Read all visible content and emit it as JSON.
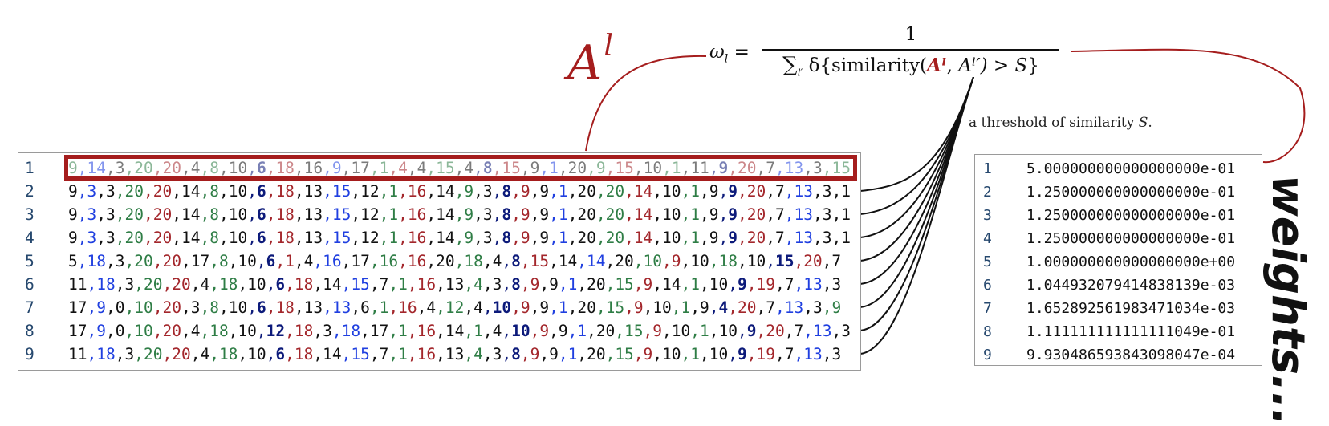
{
  "a_label": {
    "base": "A",
    "sup": "l"
  },
  "formula": {
    "lhs": "ω",
    "lhs_sub": "l",
    "eq": "=",
    "numerator": "1",
    "denominator": {
      "sum": "∑",
      "sum_sub": "l′",
      "delta": "δ{similarity(",
      "highlight": "Aˡ",
      "mid": ", ",
      "rest": "Aˡ′) > ",
      "var": "S",
      "close": "}"
    }
  },
  "threshold": {
    "text": "a threshold of similarity ",
    "var": "S",
    "end": "."
  },
  "sequences": [
    {
      "n": "1",
      "tokens": [
        [
          "9",
          "g"
        ],
        [
          "14",
          "b"
        ],
        [
          "3",
          "k"
        ],
        [
          "20",
          "g"
        ],
        [
          "20",
          "r"
        ],
        [
          "4",
          "k"
        ],
        [
          "8",
          "g"
        ],
        [
          "10",
          "k"
        ],
        [
          "6",
          "n"
        ],
        [
          "18",
          "r"
        ],
        [
          "16",
          "k"
        ],
        [
          "9",
          "b"
        ],
        [
          "17",
          "k"
        ],
        [
          "1",
          "g"
        ],
        [
          "4",
          "r"
        ],
        [
          "4",
          "k"
        ],
        [
          "15",
          "g"
        ],
        [
          "4",
          "k"
        ],
        [
          "8",
          "n"
        ],
        [
          "15",
          "r"
        ],
        [
          "9",
          "k"
        ],
        [
          "1",
          "b"
        ],
        [
          "20",
          "k"
        ],
        [
          "9",
          "g"
        ],
        [
          "15",
          "r"
        ],
        [
          "10",
          "k"
        ],
        [
          "1",
          "g"
        ],
        [
          "11",
          "k"
        ],
        [
          "9",
          "n"
        ],
        [
          "20",
          "r"
        ],
        [
          "7",
          "k"
        ],
        [
          "13",
          "b"
        ],
        [
          "3",
          "k"
        ],
        [
          "15",
          "g"
        ]
      ]
    },
    {
      "n": "2",
      "tokens": [
        [
          "9",
          "k"
        ],
        [
          "3",
          "b"
        ],
        [
          "3",
          "k"
        ],
        [
          "20",
          "g"
        ],
        [
          "20",
          "r"
        ],
        [
          "14",
          "k"
        ],
        [
          "8",
          "g"
        ],
        [
          "10",
          "k"
        ],
        [
          "6",
          "n"
        ],
        [
          "18",
          "r"
        ],
        [
          "13",
          "k"
        ],
        [
          "15",
          "b"
        ],
        [
          "12",
          "k"
        ],
        [
          "1",
          "g"
        ],
        [
          "16",
          "r"
        ],
        [
          "14",
          "k"
        ],
        [
          "9",
          "g"
        ],
        [
          "3",
          "k"
        ],
        [
          "8",
          "n"
        ],
        [
          "9",
          "r"
        ],
        [
          "9",
          "k"
        ],
        [
          "1",
          "b"
        ],
        [
          "20",
          "k"
        ],
        [
          "20",
          "g"
        ],
        [
          "14",
          "r"
        ],
        [
          "10",
          "k"
        ],
        [
          "1",
          "g"
        ],
        [
          "9",
          "k"
        ],
        [
          "9",
          "n"
        ],
        [
          "20",
          "r"
        ],
        [
          "7",
          "k"
        ],
        [
          "13",
          "b"
        ],
        [
          "3",
          "k"
        ],
        [
          "1",
          "k"
        ]
      ]
    },
    {
      "n": "3",
      "tokens": [
        [
          "9",
          "k"
        ],
        [
          "3",
          "b"
        ],
        [
          "3",
          "k"
        ],
        [
          "20",
          "g"
        ],
        [
          "20",
          "r"
        ],
        [
          "14",
          "k"
        ],
        [
          "8",
          "g"
        ],
        [
          "10",
          "k"
        ],
        [
          "6",
          "n"
        ],
        [
          "18",
          "r"
        ],
        [
          "13",
          "k"
        ],
        [
          "15",
          "b"
        ],
        [
          "12",
          "k"
        ],
        [
          "1",
          "g"
        ],
        [
          "16",
          "r"
        ],
        [
          "14",
          "k"
        ],
        [
          "9",
          "g"
        ],
        [
          "3",
          "k"
        ],
        [
          "8",
          "n"
        ],
        [
          "9",
          "r"
        ],
        [
          "9",
          "k"
        ],
        [
          "1",
          "b"
        ],
        [
          "20",
          "k"
        ],
        [
          "20",
          "g"
        ],
        [
          "14",
          "r"
        ],
        [
          "10",
          "k"
        ],
        [
          "1",
          "g"
        ],
        [
          "9",
          "k"
        ],
        [
          "9",
          "n"
        ],
        [
          "20",
          "r"
        ],
        [
          "7",
          "k"
        ],
        [
          "13",
          "b"
        ],
        [
          "3",
          "k"
        ],
        [
          "1",
          "k"
        ]
      ]
    },
    {
      "n": "4",
      "tokens": [
        [
          "9",
          "k"
        ],
        [
          "3",
          "b"
        ],
        [
          "3",
          "k"
        ],
        [
          "20",
          "g"
        ],
        [
          "20",
          "r"
        ],
        [
          "14",
          "k"
        ],
        [
          "8",
          "g"
        ],
        [
          "10",
          "k"
        ],
        [
          "6",
          "n"
        ],
        [
          "18",
          "r"
        ],
        [
          "13",
          "k"
        ],
        [
          "15",
          "b"
        ],
        [
          "12",
          "k"
        ],
        [
          "1",
          "g"
        ],
        [
          "16",
          "r"
        ],
        [
          "14",
          "k"
        ],
        [
          "9",
          "g"
        ],
        [
          "3",
          "k"
        ],
        [
          "8",
          "n"
        ],
        [
          "9",
          "r"
        ],
        [
          "9",
          "k"
        ],
        [
          "1",
          "b"
        ],
        [
          "20",
          "k"
        ],
        [
          "20",
          "g"
        ],
        [
          "14",
          "r"
        ],
        [
          "10",
          "k"
        ],
        [
          "1",
          "g"
        ],
        [
          "9",
          "k"
        ],
        [
          "9",
          "n"
        ],
        [
          "20",
          "r"
        ],
        [
          "7",
          "k"
        ],
        [
          "13",
          "b"
        ],
        [
          "3",
          "k"
        ],
        [
          "1",
          "k"
        ]
      ]
    },
    {
      "n": "5",
      "tokens": [
        [
          "5",
          "k"
        ],
        [
          "18",
          "b"
        ],
        [
          "3",
          "k"
        ],
        [
          "20",
          "g"
        ],
        [
          "20",
          "r"
        ],
        [
          "17",
          "k"
        ],
        [
          "8",
          "g"
        ],
        [
          "10",
          "k"
        ],
        [
          "6",
          "n"
        ],
        [
          "1",
          "r"
        ],
        [
          "4",
          "k"
        ],
        [
          "16",
          "b"
        ],
        [
          "17",
          "k"
        ],
        [
          "16",
          "g"
        ],
        [
          "16",
          "r"
        ],
        [
          "20",
          "k"
        ],
        [
          "18",
          "g"
        ],
        [
          "4",
          "k"
        ],
        [
          "8",
          "n"
        ],
        [
          "15",
          "r"
        ],
        [
          "14",
          "k"
        ],
        [
          "14",
          "b"
        ],
        [
          "20",
          "k"
        ],
        [
          "10",
          "g"
        ],
        [
          "9",
          "r"
        ],
        [
          "10",
          "k"
        ],
        [
          "18",
          "g"
        ],
        [
          "10",
          "k"
        ],
        [
          "15",
          "n"
        ],
        [
          "20",
          "r"
        ],
        [
          "7",
          "k"
        ]
      ]
    },
    {
      "n": "6",
      "tokens": [
        [
          "11",
          "k"
        ],
        [
          "18",
          "b"
        ],
        [
          "3",
          "k"
        ],
        [
          "20",
          "g"
        ],
        [
          "20",
          "r"
        ],
        [
          "4",
          "k"
        ],
        [
          "18",
          "g"
        ],
        [
          "10",
          "k"
        ],
        [
          "6",
          "n"
        ],
        [
          "18",
          "r"
        ],
        [
          "14",
          "k"
        ],
        [
          "15",
          "b"
        ],
        [
          "7",
          "k"
        ],
        [
          "1",
          "g"
        ],
        [
          "16",
          "r"
        ],
        [
          "13",
          "k"
        ],
        [
          "4",
          "g"
        ],
        [
          "3",
          "k"
        ],
        [
          "8",
          "n"
        ],
        [
          "9",
          "r"
        ],
        [
          "9",
          "k"
        ],
        [
          "1",
          "b"
        ],
        [
          "20",
          "k"
        ],
        [
          "15",
          "g"
        ],
        [
          "9",
          "r"
        ],
        [
          "14",
          "k"
        ],
        [
          "1",
          "g"
        ],
        [
          "10",
          "k"
        ],
        [
          "9",
          "n"
        ],
        [
          "19",
          "r"
        ],
        [
          "7",
          "k"
        ],
        [
          "13",
          "b"
        ],
        [
          "3",
          "k"
        ]
      ]
    },
    {
      "n": "7",
      "tokens": [
        [
          "17",
          "k"
        ],
        [
          "9",
          "b"
        ],
        [
          "0",
          "k"
        ],
        [
          "10",
          "g"
        ],
        [
          "20",
          "r"
        ],
        [
          "3",
          "k"
        ],
        [
          "8",
          "g"
        ],
        [
          "10",
          "k"
        ],
        [
          "6",
          "n"
        ],
        [
          "18",
          "r"
        ],
        [
          "13",
          "k"
        ],
        [
          "13",
          "b"
        ],
        [
          "6",
          "k"
        ],
        [
          "1",
          "g"
        ],
        [
          "16",
          "r"
        ],
        [
          "4",
          "k"
        ],
        [
          "12",
          "g"
        ],
        [
          "4",
          "k"
        ],
        [
          "10",
          "n"
        ],
        [
          "9",
          "r"
        ],
        [
          "9",
          "k"
        ],
        [
          "1",
          "b"
        ],
        [
          "20",
          "k"
        ],
        [
          "15",
          "g"
        ],
        [
          "9",
          "r"
        ],
        [
          "10",
          "k"
        ],
        [
          "1",
          "g"
        ],
        [
          "9",
          "k"
        ],
        [
          "4",
          "n"
        ],
        [
          "20",
          "r"
        ],
        [
          "7",
          "k"
        ],
        [
          "13",
          "b"
        ],
        [
          "3",
          "k"
        ],
        [
          "9",
          "g"
        ]
      ]
    },
    {
      "n": "8",
      "tokens": [
        [
          "17",
          "k"
        ],
        [
          "9",
          "b"
        ],
        [
          "0",
          "k"
        ],
        [
          "10",
          "g"
        ],
        [
          "20",
          "r"
        ],
        [
          "4",
          "k"
        ],
        [
          "18",
          "g"
        ],
        [
          "10",
          "k"
        ],
        [
          "12",
          "n"
        ],
        [
          "18",
          "r"
        ],
        [
          "3",
          "k"
        ],
        [
          "18",
          "b"
        ],
        [
          "17",
          "k"
        ],
        [
          "1",
          "g"
        ],
        [
          "16",
          "r"
        ],
        [
          "14",
          "k"
        ],
        [
          "1",
          "g"
        ],
        [
          "4",
          "k"
        ],
        [
          "10",
          "n"
        ],
        [
          "9",
          "r"
        ],
        [
          "9",
          "k"
        ],
        [
          "1",
          "b"
        ],
        [
          "20",
          "k"
        ],
        [
          "15",
          "g"
        ],
        [
          "9",
          "r"
        ],
        [
          "10",
          "k"
        ],
        [
          "1",
          "g"
        ],
        [
          "10",
          "k"
        ],
        [
          "9",
          "n"
        ],
        [
          "20",
          "r"
        ],
        [
          "7",
          "k"
        ],
        [
          "13",
          "b"
        ],
        [
          "3",
          "k"
        ]
      ]
    },
    {
      "n": "9",
      "tokens": [
        [
          "11",
          "k"
        ],
        [
          "18",
          "b"
        ],
        [
          "3",
          "k"
        ],
        [
          "20",
          "g"
        ],
        [
          "20",
          "r"
        ],
        [
          "4",
          "k"
        ],
        [
          "18",
          "g"
        ],
        [
          "10",
          "k"
        ],
        [
          "6",
          "n"
        ],
        [
          "18",
          "r"
        ],
        [
          "14",
          "k"
        ],
        [
          "15",
          "b"
        ],
        [
          "7",
          "k"
        ],
        [
          "1",
          "g"
        ],
        [
          "16",
          "r"
        ],
        [
          "13",
          "k"
        ],
        [
          "4",
          "g"
        ],
        [
          "3",
          "k"
        ],
        [
          "8",
          "n"
        ],
        [
          "9",
          "r"
        ],
        [
          "9",
          "k"
        ],
        [
          "1",
          "b"
        ],
        [
          "20",
          "k"
        ],
        [
          "15",
          "g"
        ],
        [
          "9",
          "r"
        ],
        [
          "10",
          "k"
        ],
        [
          "1",
          "g"
        ],
        [
          "10",
          "k"
        ],
        [
          "9",
          "n"
        ],
        [
          "19",
          "r"
        ],
        [
          "7",
          "k"
        ],
        [
          "13",
          "b"
        ],
        [
          "3",
          "k"
        ]
      ]
    }
  ],
  "token_colors": {
    "k": "#111111",
    "b": "#1f3fe0",
    "g": "#2e7d45",
    "r": "#a3262b",
    "n": "#0c1a7a"
  },
  "weights": [
    {
      "n": "1",
      "value": "5.000000000000000000e-01"
    },
    {
      "n": "2",
      "value": "1.250000000000000000e-01"
    },
    {
      "n": "3",
      "value": "1.250000000000000000e-01"
    },
    {
      "n": "4",
      "value": "1.250000000000000000e-01"
    },
    {
      "n": "5",
      "value": "1.000000000000000000e+00"
    },
    {
      "n": "6",
      "value": "1.044932079414838139e-03"
    },
    {
      "n": "7",
      "value": "1.652892561983471034e-03"
    },
    {
      "n": "8",
      "value": "1.111111111111111049e-01"
    },
    {
      "n": "9",
      "value": "9.930486593843098047e-04"
    }
  ],
  "weights_word": "weights...",
  "accent_color": "#a51d1d"
}
